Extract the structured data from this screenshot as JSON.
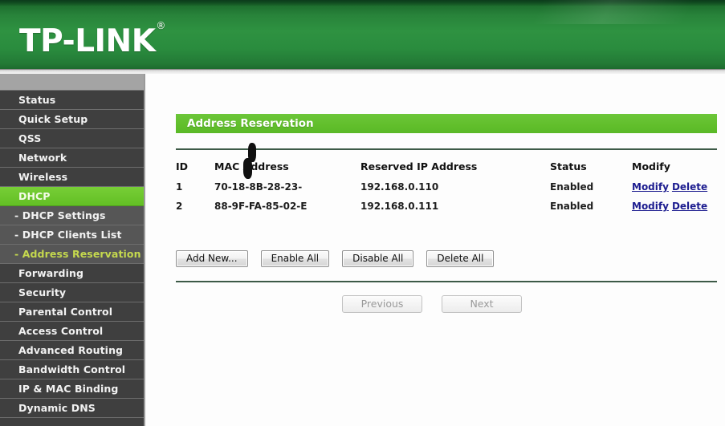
{
  "brand": {
    "name": "TP-LINK",
    "registered_mark": "®"
  },
  "sidebar": {
    "items": [
      {
        "label": "Status",
        "type": "top",
        "state": "normal"
      },
      {
        "label": "Quick Setup",
        "type": "top",
        "state": "normal"
      },
      {
        "label": "QSS",
        "type": "top",
        "state": "normal"
      },
      {
        "label": "Network",
        "type": "top",
        "state": "normal"
      },
      {
        "label": "Wireless",
        "type": "top",
        "state": "normal"
      },
      {
        "label": "DHCP",
        "type": "top",
        "state": "active-parent"
      },
      {
        "label": "- DHCP Settings",
        "type": "sub",
        "state": "normal"
      },
      {
        "label": "- DHCP Clients List",
        "type": "sub",
        "state": "normal"
      },
      {
        "label": "- Address Reservation",
        "type": "sub",
        "state": "active-sub"
      },
      {
        "label": "Forwarding",
        "type": "top",
        "state": "normal"
      },
      {
        "label": "Security",
        "type": "top",
        "state": "normal"
      },
      {
        "label": "Parental Control",
        "type": "top",
        "state": "normal"
      },
      {
        "label": "Access Control",
        "type": "top",
        "state": "normal"
      },
      {
        "label": "Advanced Routing",
        "type": "top",
        "state": "normal"
      },
      {
        "label": "Bandwidth Control",
        "type": "top",
        "state": "normal"
      },
      {
        "label": "IP & MAC Binding",
        "type": "top",
        "state": "normal"
      },
      {
        "label": "Dynamic DNS",
        "type": "top",
        "state": "normal"
      }
    ]
  },
  "main": {
    "section_title": "Address Reservation",
    "table": {
      "columns": [
        "ID",
        "MAC Address",
        "Reserved IP Address",
        "Status",
        "Modify"
      ],
      "rows": [
        {
          "id": "1",
          "mac": "70-18-8B-28-23-",
          "mac_redacted": true,
          "ip": "192.168.0.110",
          "status": "Enabled",
          "modify_label": "Modify",
          "delete_label": "Delete"
        },
        {
          "id": "2",
          "mac": "88-9F-FA-85-02-E",
          "mac_redacted": true,
          "ip": "192.168.0.111",
          "status": "Enabled",
          "modify_label": "Modify",
          "delete_label": "Delete"
        }
      ]
    },
    "buttons": [
      {
        "label": "Add New...",
        "enabled": true
      },
      {
        "label": "Enable All",
        "enabled": true
      },
      {
        "label": "Disable All",
        "enabled": true
      },
      {
        "label": "Delete All",
        "enabled": true
      }
    ],
    "pagination": [
      {
        "label": "Previous",
        "enabled": false
      },
      {
        "label": "Next",
        "enabled": false
      }
    ]
  },
  "colors": {
    "brand_green": "#2e9241",
    "title_bar_green": "#62bf2c",
    "nav_active_green": "#6bc82e",
    "nav_active_sub_text": "#c5d94e",
    "sidebar_bg": "#3f3f3f",
    "sidebar_sub_bg": "#565656",
    "link_blue": "#1c1c8f",
    "rule": "#3d5a47"
  }
}
